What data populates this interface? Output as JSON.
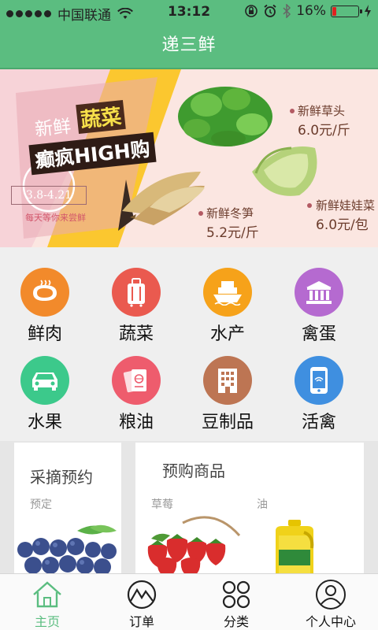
{
  "status_bar": {
    "carrier": "中国联通",
    "time": "13:12",
    "battery_percent": "16%",
    "battery_level": 0.16,
    "icons": [
      "signal-dots",
      "wifi-icon",
      "rotation-lock-icon",
      "alarm-icon",
      "bluetooth-icon",
      "battery-icon",
      "charging-icon"
    ]
  },
  "header": {
    "title": "递三鲜"
  },
  "banner": {
    "headline_prefix": "新鲜",
    "headline_highlight": "蔬菜",
    "headline_main": "癫疯HIGH购",
    "date_range": "3.8-4.21",
    "slogan": "每天等你来尝鲜",
    "products": [
      {
        "name": "新鲜草头",
        "price": "6.0元/斤"
      },
      {
        "name": "新鲜冬笋",
        "price": "5.2元/斤"
      },
      {
        "name": "新鲜娃娃菜",
        "price": "6.0元/包"
      }
    ],
    "colors": {
      "background": "#fbe6e1",
      "accent_yellow": "#fbc72f",
      "accent_pink": "#e7b8bf"
    }
  },
  "categories": [
    {
      "label": "鲜肉",
      "icon": "steak-icon",
      "color": "#f28a2b"
    },
    {
      "label": "蔬菜",
      "icon": "luggage-icon",
      "color": "#ea5a4f"
    },
    {
      "label": "水产",
      "icon": "ship-icon",
      "color": "#f6a21a"
    },
    {
      "label": "禽蛋",
      "icon": "bank-icon",
      "color": "#b56ad0"
    },
    {
      "label": "水果",
      "icon": "car-icon",
      "color": "#3cc98b"
    },
    {
      "label": "粮油",
      "icon": "passport-icon",
      "color": "#ee5c6d"
    },
    {
      "label": "豆制品",
      "icon": "building-icon",
      "color": "#bd7553"
    },
    {
      "label": "活禽",
      "icon": "phone-wifi-icon",
      "color": "#3f8fe0"
    }
  ],
  "cards": {
    "pick": {
      "title": "采摘预约",
      "subtitle": "预定",
      "image": "blueberries"
    },
    "presale": {
      "title": "预购商品",
      "items": [
        {
          "label": "草莓",
          "image": "strawberries"
        },
        {
          "label": "油",
          "image": "cooking-oil"
        }
      ]
    }
  },
  "tabbar": {
    "active_color": "#5bbd80",
    "tabs": [
      {
        "label": "主页",
        "icon": "home-icon",
        "active": true
      },
      {
        "label": "订单",
        "icon": "mountain-icon",
        "active": false
      },
      {
        "label": "分类",
        "icon": "grid-circles-icon",
        "active": false
      },
      {
        "label": "个人中心",
        "icon": "user-icon",
        "active": false
      }
    ]
  }
}
